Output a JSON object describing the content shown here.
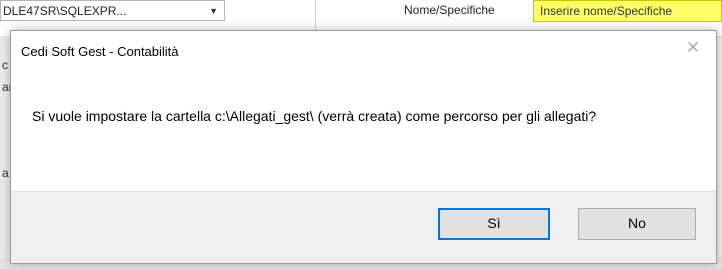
{
  "background": {
    "combo_text": "DLE47SR\\SQLEXPR...",
    "combo_arrow": "▼",
    "field_label": "Nome/Specifiche",
    "field_placeholder": "Inserire nome/Specifiche",
    "left_stubs": [
      "c",
      "ar",
      "a"
    ],
    "accent_yellow": "#ffff66"
  },
  "dialog": {
    "title": "Cedi Soft Gest - Contabilità",
    "close_icon": "close-icon",
    "message": "Si vuole impostare la cartella c:\\Allegati_gest\\ (verrà creata) come percorso per gli allegati?",
    "buttons": {
      "yes_label": "Sì",
      "no_label": "No"
    },
    "focus_color": "#0078d7"
  }
}
